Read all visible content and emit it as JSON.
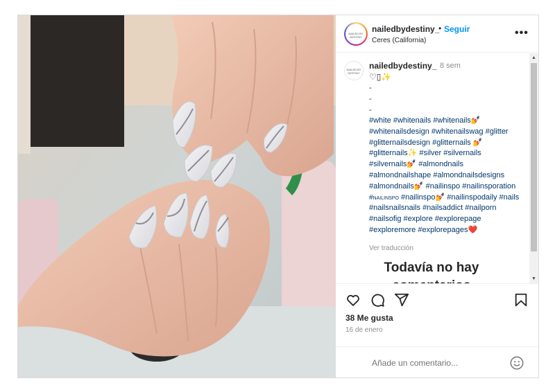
{
  "post": {
    "username": "nailedbydestiny_",
    "avatar_text": "NAILED BY DESTINY",
    "dot": "•",
    "follow_label": "Seguir",
    "location": "Ceres (California)",
    "more_label": "•••",
    "caption": {
      "username": "nailedbydestiny_",
      "time": "8 sem",
      "emoji_line_heart": "♡",
      "emoji_line_box": "▯",
      "emoji_line_spark": "✨",
      "dashes": [
        "-",
        "-",
        "-"
      ],
      "hashtags": [
        "#white",
        "#whitenails",
        "#whitenails",
        "#whitenailsdesign",
        "#whitenailswag",
        "#glitter",
        "#glitternailsdesign",
        "#glitternails",
        "#glitternails",
        "#silver",
        "#silvernails",
        "#silvernails",
        "#almondnails",
        "#almondnailshape",
        "#almondnailsdesigns",
        "#almondnails",
        "#nailinspo",
        "#nailinsporation",
        "#nailinspo",
        "#nailinspo",
        "#nailinspodaily",
        "#nails",
        "#nailsnailsnails",
        "#nailsaddict",
        "#nailporn",
        "#nailsofig",
        "#explore",
        "#explorepage",
        "#exploremore",
        "#explorepages"
      ],
      "emoji_nail": "💅",
      "emoji_spark": "✨",
      "emoji_heart": "❤️",
      "translate_label": "Ver traducción"
    },
    "no_comments_title": "Todavía no hay",
    "no_comments_subtitle": "comentarios",
    "scroll_up": "▲",
    "scroll_down": "▼",
    "likes": "38 Me gusta",
    "date": "16 de enero",
    "comment_placeholder": "Añade un comentario..."
  },
  "colors": {
    "link_blue": "#0095f6",
    "hashtag_blue": "#00376b",
    "muted_gray": "#8e8e8e",
    "text": "#262626"
  },
  "icons": [
    "heart-icon",
    "comment-icon",
    "share-icon",
    "bookmark-icon",
    "emoji-icon",
    "more-icon"
  ]
}
